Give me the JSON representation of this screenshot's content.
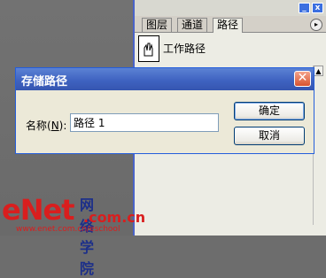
{
  "panel": {
    "tabs": [
      "图层",
      "通道",
      "路径"
    ],
    "active_tab": "路径",
    "path_item": "工作路径",
    "minimize_label": "_",
    "close_label": "x",
    "menu_label": "▸"
  },
  "dialog": {
    "title": "存储路径",
    "close_label": "✕",
    "name_label_prefix": "名称(",
    "name_label_key": "N",
    "name_label_suffix": "):",
    "name_value": "路径 1",
    "ok_label": "确定",
    "cancel_label": "取消"
  },
  "watermark": {
    "brand": "eNet",
    "chinese": "网络学院",
    "domain": ".com.cn",
    "url": "www.enet.com.cn/eschool"
  },
  "colors": {
    "titlebar": "#3f63c1",
    "brand_red": "#d91e1e",
    "brand_blue": "#1c2f8a"
  }
}
